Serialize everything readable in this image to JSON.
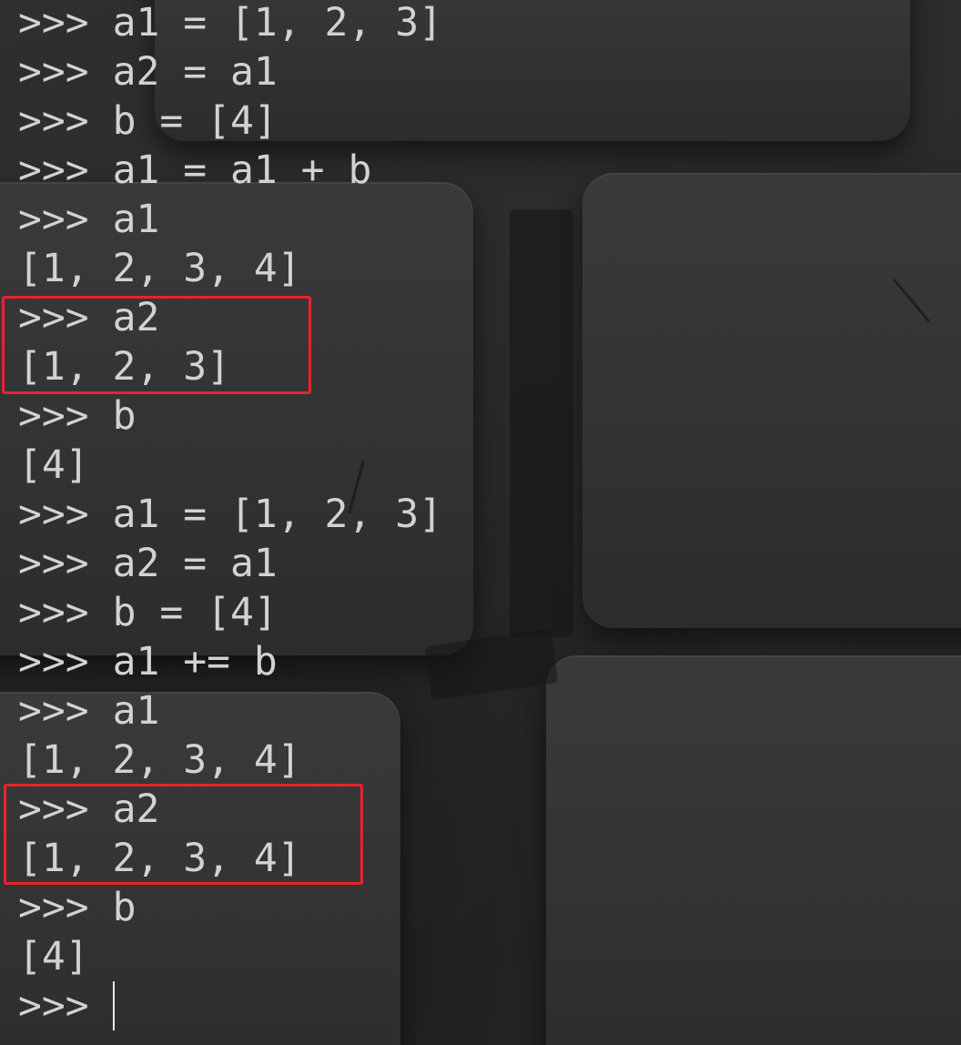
{
  "terminal": {
    "prompt": ">>> ",
    "lines": [
      {
        "type": "input",
        "text": "a1 = [1, 2, 3]"
      },
      {
        "type": "input",
        "text": "a2 = a1"
      },
      {
        "type": "input",
        "text": "b = [4]"
      },
      {
        "type": "input",
        "text": "a1 = a1 + b"
      },
      {
        "type": "input",
        "text": "a1"
      },
      {
        "type": "output",
        "text": "[1, 2, 3, 4]"
      },
      {
        "type": "input",
        "text": "a2"
      },
      {
        "type": "output",
        "text": "[1, 2, 3]"
      },
      {
        "type": "input",
        "text": "b"
      },
      {
        "type": "output",
        "text": "[4]"
      },
      {
        "type": "input",
        "text": "a1 = [1, 2, 3]"
      },
      {
        "type": "input",
        "text": "a2 = a1"
      },
      {
        "type": "input",
        "text": "b = [4]"
      },
      {
        "type": "input",
        "text": "a1 += b"
      },
      {
        "type": "input",
        "text": "a1"
      },
      {
        "type": "output",
        "text": "[1, 2, 3, 4]"
      },
      {
        "type": "input",
        "text": "a2"
      },
      {
        "type": "output",
        "text": "[1, 2, 3, 4]"
      },
      {
        "type": "input",
        "text": "b"
      },
      {
        "type": "output",
        "text": "[4]"
      },
      {
        "type": "input",
        "text": ""
      }
    ]
  },
  "colors": {
    "text": "#d2d2d2",
    "highlight": "#e8232c",
    "background": "#2b2b2c"
  }
}
